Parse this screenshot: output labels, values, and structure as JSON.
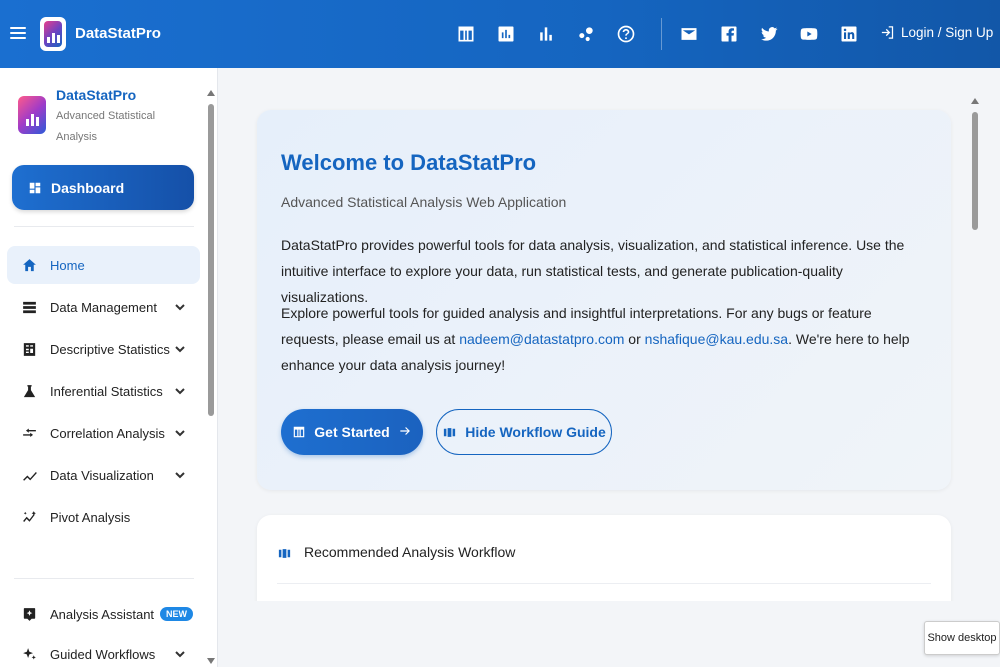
{
  "topbar": {
    "brand": "DataStatPro",
    "login_label": "Login / Sign Up",
    "nav_icons": [
      "table-icon",
      "bar-chart-icon",
      "column-chart-icon",
      "scatter-icon",
      "help-icon"
    ],
    "social_icons": [
      "mail-icon",
      "facebook-icon",
      "twitter-icon",
      "youtube-icon",
      "linkedin-icon"
    ]
  },
  "sidebar": {
    "title": "DataStatPro",
    "subtitle": "Advanced Statistical Analysis",
    "dashboard_label": "Dashboard",
    "items": [
      {
        "label": "Home",
        "icon": "home-icon",
        "active": true
      },
      {
        "label": "Data Management",
        "icon": "storage-icon"
      },
      {
        "label": "Descriptive Statistics",
        "icon": "calculator-icon"
      },
      {
        "label": "Inferential Statistics",
        "icon": "flask-icon"
      },
      {
        "label": "Correlation Analysis",
        "icon": "compare-arrows-icon"
      },
      {
        "label": "Data Visualization",
        "icon": "line-chart-icon"
      },
      {
        "label": "Pivot Analysis",
        "icon": "pivot-icon"
      },
      {
        "label": "Analysis Assistant",
        "icon": "assistant-icon",
        "badge": "NEW"
      },
      {
        "label": "Guided Workflows",
        "icon": "sparkle-icon"
      }
    ]
  },
  "welcome": {
    "title": "Welcome to DataStatPro",
    "subtitle": "Advanced Statistical Analysis Web Application",
    "paragraph1": "DataStatPro provides powerful tools for data analysis, visualization, and statistical inference. Use the intuitive interface to explore your data, run statistical tests, and generate publication-quality visualizations.",
    "paragraph2_prefix": "Explore powerful tools for guided analysis and insightful interpretations. For any bugs or feature requests, please email us at ",
    "email1": "nadeem@datastatpro.com",
    "paragraph2_mid": " or ",
    "email2": "nshafique@kau.edu.sa",
    "paragraph2_suffix": ". We're here to help enhance your data analysis journey!",
    "get_started_label": "Get Started",
    "hide_guide_label": "Hide Workflow Guide"
  },
  "workflow": {
    "title": "Recommended Analysis Workflow"
  },
  "taskbar": {
    "show_desktop": "Show desktop"
  },
  "colors": {
    "accent": "#1565c0",
    "topbar": "#1a6fd0"
  }
}
